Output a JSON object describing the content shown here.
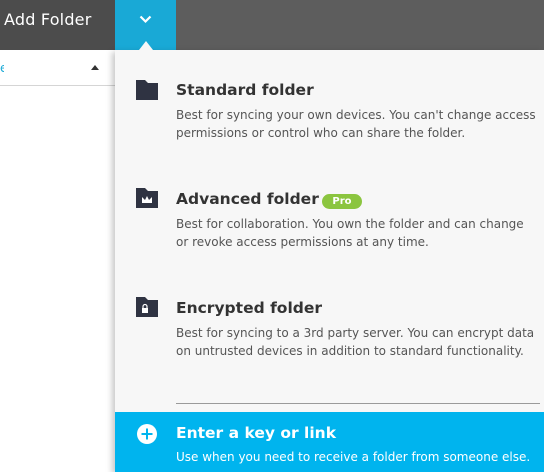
{
  "header": {
    "add_folder_label": "Add Folder",
    "dropdown_icon": "chevron-down-icon",
    "accent_color": "#19a9d6"
  },
  "left_panel": {
    "sort_icon": "sort-caret-up-icon"
  },
  "menu": {
    "options": [
      {
        "icon": "folder-icon",
        "title": "Standard folder",
        "description": "Best for syncing your own devices. You can't change access permissions or control who can share the folder."
      },
      {
        "icon": "folder-crown-icon",
        "title": "Advanced folder",
        "badge": "Pro",
        "badge_color": "#8bc53f",
        "description": "Best for collaboration. You own the folder and can change or revoke access permissions at any time."
      },
      {
        "icon": "folder-lock-icon",
        "title": "Encrypted folder",
        "description": "Best for syncing to a 3rd party server. You can encrypt data on untrusted devices in addition to standard functionality."
      }
    ],
    "key_option": {
      "icon": "plus-circle-icon",
      "title": "Enter a key or link",
      "description": "Use when you need to receive a folder from someone else.",
      "background_color": "#00b4ee"
    }
  }
}
